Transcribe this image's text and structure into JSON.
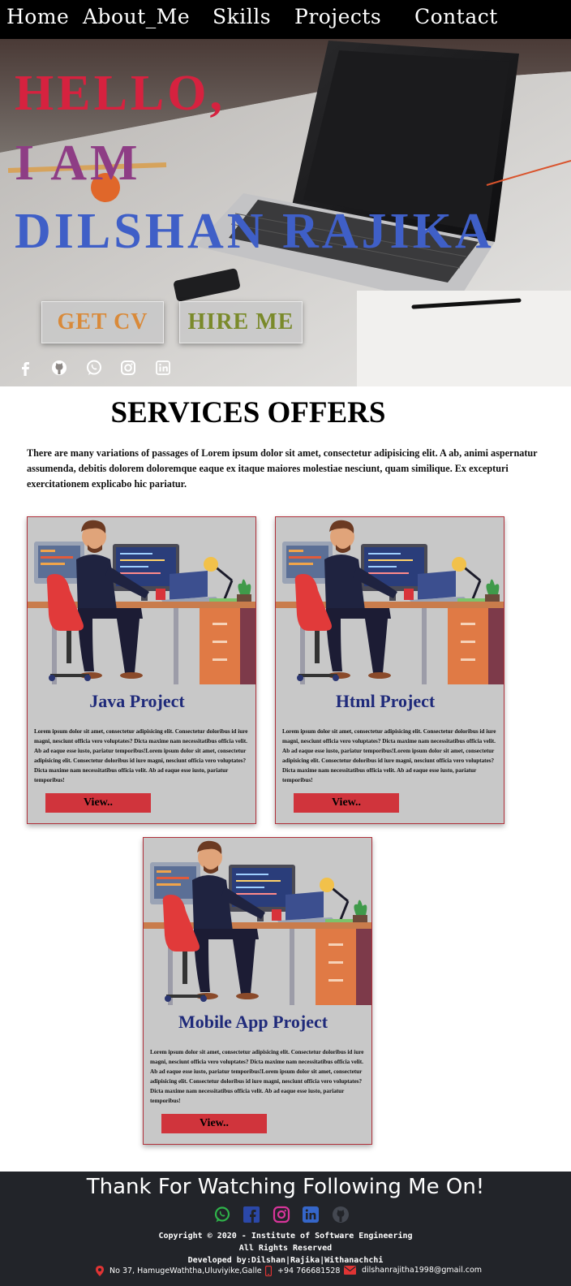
{
  "nav": {
    "items": [
      {
        "label": "Home"
      },
      {
        "label": "About_Me"
      },
      {
        "label": "Skills"
      },
      {
        "label": "Projects"
      },
      {
        "label": "Contact"
      }
    ]
  },
  "hero": {
    "line1": "HELLO,",
    "line2": "I AM",
    "line3": "DILSHAN RAJIKA",
    "cv_button": "GET CV",
    "hire_button": "HIRE ME",
    "social_icons": [
      "facebook-icon",
      "github-icon",
      "whatsapp-icon",
      "instagram-icon",
      "linkedin-icon"
    ]
  },
  "services": {
    "title": "SERVICES OFFERS",
    "description": "There are many variations of passages of Lorem ipsum dolor sit amet, consectetur adipisicing elit. A ab, animi aspernatur assumenda, debitis dolorem doloremque eaque ex itaque maiores molestiae nesciunt, quam similique. Ex excepturi exercitationem explicabo hic pariatur.",
    "cards": [
      {
        "title": "Java Project",
        "text": "Lorem ipsum dolor sit amet, consectetur adipisicing elit. Consectetur doloribus id iure magni, nesciunt officia vero voluptates? Dicta maxime nam necessitatibus officia velit. Ab ad eaque esse iusto, pariatur temporibus!Lorem ipsum dolor sit amet, consectetur adipisicing elit. Consectetur doloribus id iure magni, nesciunt officia vero voluptates? Dicta maxime nam necessitatibus officia velit. Ab ad eaque esse iusto, pariatur temporibus!",
        "button": "View.."
      },
      {
        "title": "Html Project",
        "text": "Lorem ipsum dolor sit amet, consectetur adipisicing elit. Consectetur doloribus id iure magni, nesciunt officia vero voluptates? Dicta maxime nam necessitatibus officia velit. Ab ad eaque esse iusto, pariatur temporibus!Lorem ipsum dolor sit amet, consectetur adipisicing elit. Consectetur doloribus id iure magni, nesciunt officia vero voluptates? Dicta maxime nam necessitatibus officia velit. Ab ad eaque esse iusto, pariatur temporibus!",
        "button": "View.."
      },
      {
        "title": "Mobile App Project",
        "text": "Lorem ipsum dolor sit amet, consectetur adipisicing elit. Consectetur doloribus id iure magni, nesciunt officia vero voluptates? Dicta maxime nam necessitatibus officia velit. Ab ad eaque esse iusto, pariatur temporibus!Lorem ipsum dolor sit amet, consectetur adipisicing elit. Consectetur doloribus id iure magni, nesciunt officia vero voluptates? Dicta maxime nam necessitatibus officia velit. Ab ad eaque esse iusto, pariatur temporibus!",
        "button": "View.."
      }
    ]
  },
  "footer": {
    "heading": "Thank For Watching Following Me On!",
    "icons": [
      "whatsapp-icon",
      "facebook-icon",
      "instagram-icon",
      "linkedin-icon",
      "github-icon"
    ],
    "copyright": "Copyright © 2020 - Institute of Software Engineering",
    "rights": "All Rights Reserved",
    "developer": "Developed by:Dilshan|Rajika|Withanachchi",
    "address": "No 37, HamugeWaththa,Uluviyike,Galle",
    "phone": "+94 766681528",
    "email": "dilshanrajitha1998@gmail.com"
  },
  "colors": {
    "nav_bg": "#000000",
    "hello": "#d6223f",
    "i_am": "#8e3d85",
    "name": "#3f5fc7",
    "card_bg": "#c8c8c8",
    "card_border": "#b0303a",
    "card_title": "#1f2a7a",
    "view_button": "#d0343c",
    "footer_bg": "#222429"
  }
}
